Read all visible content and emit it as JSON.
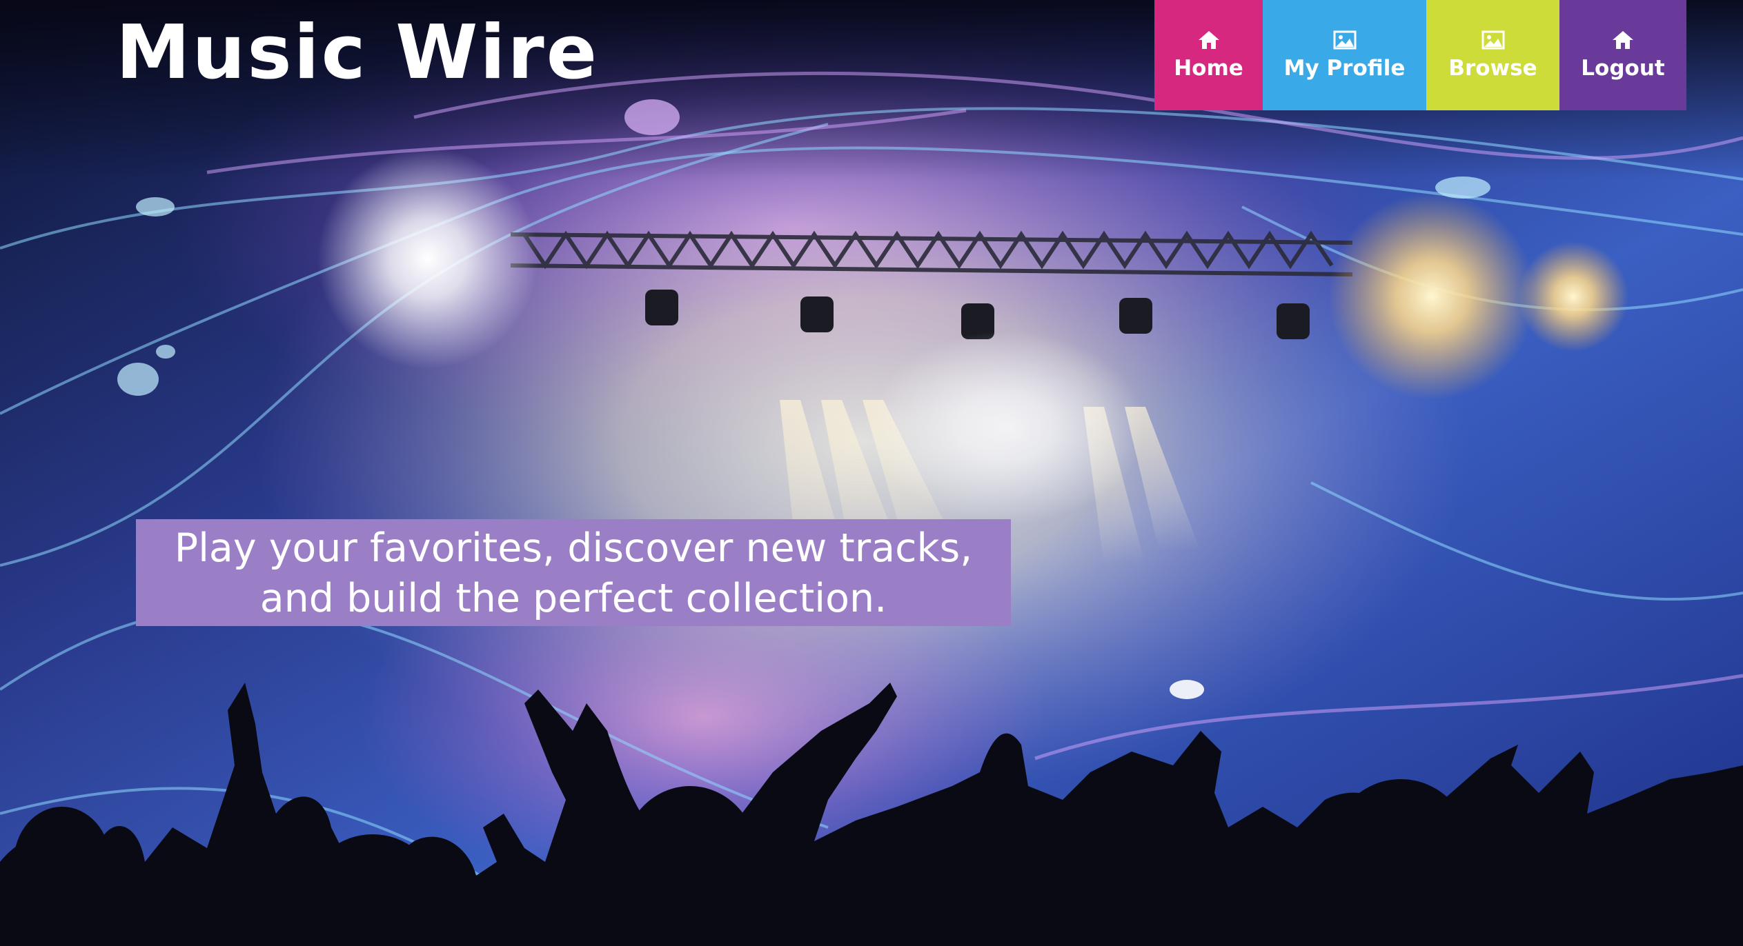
{
  "brand": {
    "title": "Music Wire"
  },
  "nav": {
    "items": [
      {
        "label": "Home",
        "icon": "home-icon",
        "color": "#d6287f"
      },
      {
        "label": "My Profile",
        "icon": "image-icon",
        "color": "#3aa9e8"
      },
      {
        "label": "Browse",
        "icon": "image-icon",
        "color": "#cddc39"
      },
      {
        "label": "Logout",
        "icon": "home-icon",
        "color": "#6a3a9a"
      }
    ]
  },
  "hero": {
    "tagline_line1": "Play your favorites, discover new tracks,",
    "tagline_line2": "and build the perfect collection.",
    "tagline_bg": "#9b7fc6"
  }
}
